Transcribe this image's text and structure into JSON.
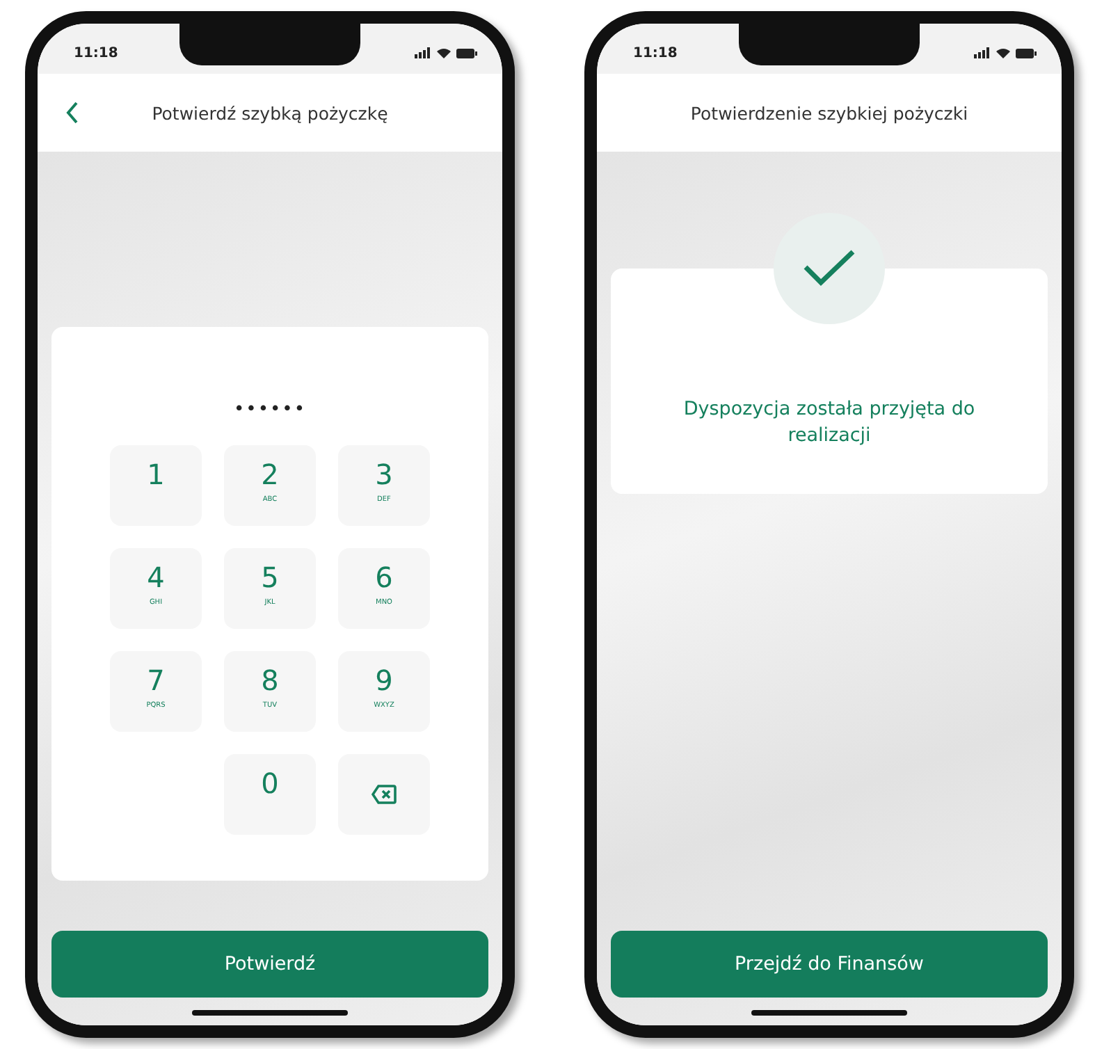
{
  "phones": [
    {
      "kind": "pin",
      "status_bar": {
        "time": "11:18"
      },
      "header": {
        "title": "Potwierdź szybką pożyczkę",
        "back": true
      },
      "pin_mask": "••••••",
      "keys": [
        {
          "kind": "digit",
          "digit": "1"
        },
        {
          "kind": "digit",
          "digit": "2",
          "letters": "ABC"
        },
        {
          "kind": "digit",
          "digit": "3",
          "letters": "DEF"
        },
        {
          "kind": "digit",
          "digit": "4",
          "letters": "GHI"
        },
        {
          "kind": "digit",
          "digit": "5",
          "letters": "JKL"
        },
        {
          "kind": "digit",
          "digit": "6",
          "letters": "MNO"
        },
        {
          "kind": "digit",
          "digit": "7",
          "letters": "PQRS"
        },
        {
          "kind": "digit",
          "digit": "8",
          "letters": "TUV"
        },
        {
          "kind": "digit",
          "digit": "9",
          "letters": "WXYZ"
        },
        {
          "kind": "digit",
          "digit": "0"
        },
        {
          "kind": "backspace"
        }
      ],
      "button": "Potwierdź"
    },
    {
      "kind": "success",
      "status_bar": {
        "time": "11:18"
      },
      "header": {
        "title": "Potwierdzenie szybkiej pożyczki",
        "back": false
      },
      "message": "Dyspozycja została przyjęta do realizacji",
      "button": "Przejdź do Finansów"
    }
  ]
}
